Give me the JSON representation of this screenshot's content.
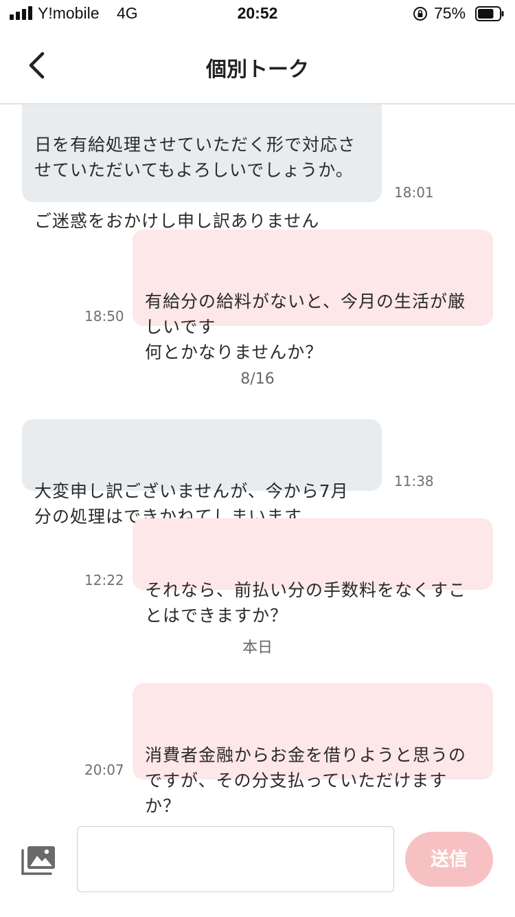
{
  "status_bar": {
    "carrier": "Y!mobile",
    "network": "4G",
    "time": "20:52",
    "battery_percent": "75%",
    "battery_level": 0.75,
    "icons": [
      "signal-icon",
      "rotation-lock-icon",
      "battery-icon"
    ]
  },
  "nav": {
    "title": "個別トーク",
    "back_icon": "chevron-left-icon"
  },
  "messages": [
    {
      "side": "in",
      "text": "日を有給処理させていただく形で対応させていただいてもよろしいでしょうか。\n\nご迷惑をおかけし申し訳ありません",
      "visible_text": "日を有給処理させていただく形で対応さ\nせていただいてもよろしいでしょうか。\n\nご迷惑をおかけし申し訳ありません",
      "time": "18:01"
    },
    {
      "side": "out",
      "text": "有給分の給料がないと、今月の生活が厳しいです\n何とかなりませんか？",
      "visible_text": "有給分の給料がないと、今月の生活が厳\nしいです\n何とかなりませんか？",
      "time": "18:50"
    },
    {
      "side": "in",
      "text": "大変申し訳ございませんが、今から7月分の処理はできかねてしまいます。",
      "visible_text": "大変申し訳ございませんが、今から7月\n分の処理はできかねてしまいます。",
      "time": "11:38"
    },
    {
      "side": "out",
      "text": "それなら、前払い分の手数料をなくすことはできますか？",
      "visible_text": "それなら、前払い分の手数料をなくすこ\nとはできますか？",
      "time": "12:22"
    },
    {
      "side": "out",
      "text": "消費者金融からお金を借りようと思うのですが、その分支払っていただけますか？",
      "visible_text": "消費者金融からお金を借りようと思うの\nですが、その分支払っていただけます\nか？",
      "time": "20:07"
    }
  ],
  "date_separators": [
    "8/16",
    "本日"
  ],
  "composer": {
    "photo_icon": "photo-library-icon",
    "input_value": "",
    "input_placeholder": "",
    "send_label": "送信"
  },
  "colors": {
    "incoming_bubble": "#e8ecef",
    "outgoing_bubble": "#fde7e8",
    "send_button": "#f7c1c3"
  }
}
